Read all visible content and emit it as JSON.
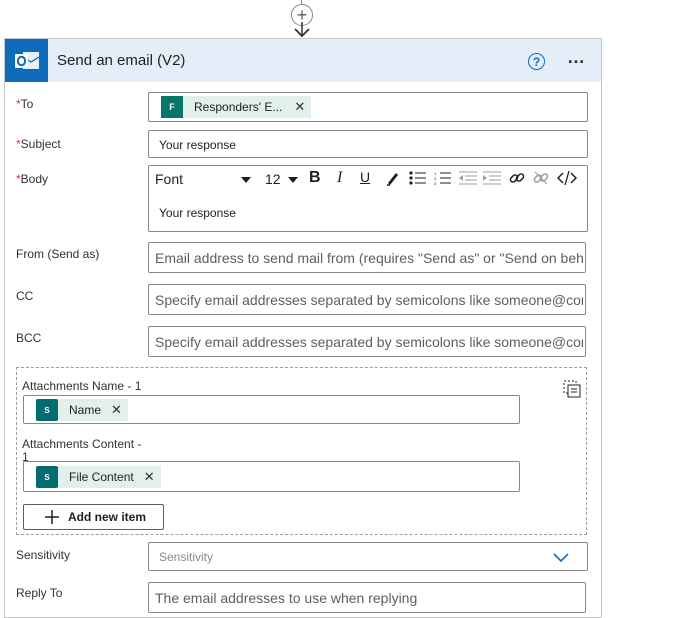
{
  "card": {
    "title": "Send an email (V2)",
    "help_glyph": "?",
    "more_glyph": "…"
  },
  "fields": {
    "to": {
      "required": "*",
      "label": "To",
      "token_label": "Responders' E...",
      "token_icon": "microsoft-forms-icon"
    },
    "subject": {
      "required": "*",
      "label": "Subject",
      "value": "Your response"
    },
    "body": {
      "required": "*",
      "label": "Body",
      "value": "Your response",
      "font_select": "Font",
      "size_select": "12",
      "bold": "B",
      "italic": "I",
      "underline": "U"
    },
    "from": {
      "label": "From (Send as)",
      "placeholder": "Email address to send mail from (requires \"Send as\" or \"Send on behalf of\" permission)"
    },
    "cc": {
      "label": "CC",
      "placeholder": "Specify email addresses separated by semicolons like someone@contoso.com"
    },
    "bcc": {
      "label": "BCC",
      "placeholder": "Specify email addresses separated by semicolons like someone@contoso.com"
    },
    "attachments": {
      "name_label": "Attachments Name - 1",
      "name_token": "Name",
      "content_label_line1": "Attachments Content -",
      "content_label_line2": "1",
      "content_token": "File Content",
      "add_label": "Add new item"
    },
    "sensitivity": {
      "label": "Sensitivity",
      "placeholder": "Sensitivity"
    },
    "reply_to": {
      "label": "Reply To",
      "placeholder": "The email addresses to use when replying"
    }
  },
  "colors": {
    "header_bg": "#e3eef9",
    "outlook_blue": "#0f6cbd",
    "token_bg": "#e1f0ea",
    "sharepoint_teal": "#036c70",
    "required_red": "#d13438"
  }
}
